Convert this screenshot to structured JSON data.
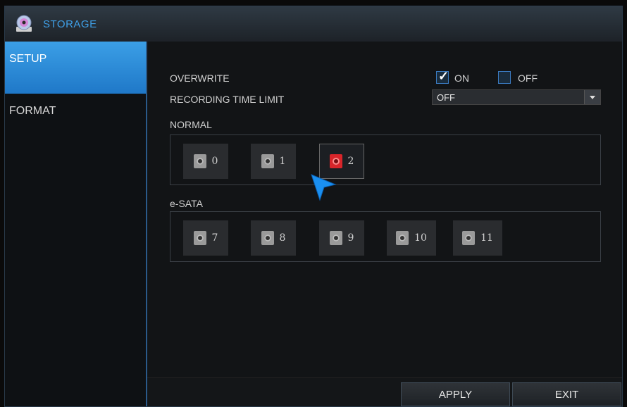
{
  "window": {
    "title": "STORAGE",
    "icon": "storage-disc-icon"
  },
  "sidebar": {
    "items": [
      {
        "label": "SETUP",
        "active": true
      },
      {
        "label": "FORMAT",
        "active": false
      }
    ]
  },
  "settings": {
    "overwrite_label": "OVERWRITE",
    "overwrite_on_label": "ON",
    "overwrite_off_label": "OFF",
    "overwrite_value": "ON",
    "recording_time_limit_label": "RECORDING TIME LIMIT",
    "recording_time_limit_value": "OFF"
  },
  "groups": {
    "normal": {
      "label": "NORMAL",
      "disks": [
        {
          "id": "0",
          "status": "normal"
        },
        {
          "id": "1",
          "status": "normal"
        },
        {
          "id": "2",
          "status": "error",
          "selected": true
        }
      ]
    },
    "esata": {
      "label": "e-SATA",
      "disks": [
        {
          "id": "7"
        },
        {
          "id": "8"
        },
        {
          "id": "9"
        },
        {
          "id": "10"
        },
        {
          "id": "11"
        }
      ]
    }
  },
  "footer": {
    "apply_label": "APPLY",
    "exit_label": "EXIT"
  },
  "colors": {
    "accent": "#3b9fe6",
    "title_text": "#3fa0e8",
    "error_disk": "#d8252a"
  }
}
